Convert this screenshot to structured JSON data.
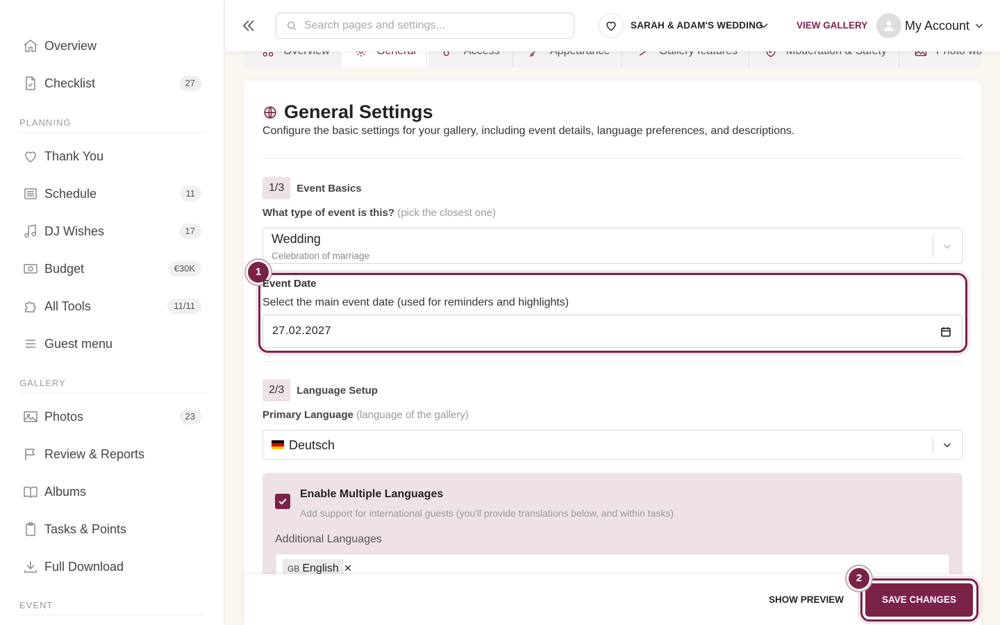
{
  "sidebar": {
    "top_items": [
      {
        "label": "Overview",
        "icon": "home-icon"
      },
      {
        "label": "Checklist",
        "icon": "checklist-icon",
        "badge": "27"
      }
    ],
    "sections": [
      {
        "title": "PLANNING"
      },
      {
        "title": "GALLERY"
      },
      {
        "title": "EVENT"
      }
    ],
    "planning_items": [
      {
        "label": "Thank You",
        "icon": "heart-icon"
      },
      {
        "label": "Schedule",
        "icon": "list-icon",
        "badge": "11"
      },
      {
        "label": "DJ Wishes",
        "icon": "music-note-icon",
        "badge": "17"
      },
      {
        "label": "Budget",
        "icon": "money-icon",
        "badge": "€30K"
      },
      {
        "label": "All Tools",
        "icon": "puzzle-icon",
        "badge": "11/11"
      },
      {
        "label": "Guest menu",
        "icon": "menu-icon"
      }
    ],
    "gallery_items": [
      {
        "label": "Photos",
        "icon": "image-icon",
        "badge": "23"
      },
      {
        "label": "Review & Reports",
        "icon": "flag-icon"
      },
      {
        "label": "Albums",
        "icon": "book-icon"
      },
      {
        "label": "Tasks & Points",
        "icon": "clipboard-icon"
      },
      {
        "label": "Full Download",
        "icon": "download-icon"
      }
    ]
  },
  "topbar": {
    "search_placeholder": "Search pages and settings...",
    "event_name": "SARAH & ADAM'S WEDDING",
    "view_gallery": "VIEW GALLERY",
    "account_label": "My Account"
  },
  "tabs": [
    "Overview",
    "General",
    "Access",
    "Appearance",
    "Gallery features",
    "Moderation & Safety",
    "Photo wa"
  ],
  "main": {
    "title": "General Settings",
    "description": "Configure the basic settings for your gallery, including event details, language preferences, and descriptions.",
    "step1": {
      "badge": "1/3",
      "title": "Event Basics"
    },
    "event_type": {
      "label": "What type of event is this?",
      "hint": "(pick the closest one)",
      "value": "Wedding",
      "sub": "Celebration of marriage"
    },
    "event_date": {
      "label": "Event Date",
      "description": "Select the main event date (used for reminders and highlights)",
      "value": "27.02.2027"
    },
    "step2": {
      "badge": "2/3",
      "title": "Language Setup"
    },
    "primary_language": {
      "label": "Primary Language",
      "hint": "(language of the gallery)",
      "value": "Deutsch"
    },
    "multi_lang": {
      "title": "Enable Multiple Languages",
      "description": "Add support for international guests (you'll provide translations below, and within tasks)",
      "checked": true,
      "additional_label": "Additional Languages",
      "chips": [
        {
          "code": "GB",
          "name": "English"
        }
      ]
    }
  },
  "markers": [
    "1",
    "2"
  ],
  "actions": {
    "show_preview": "SHOW PREVIEW",
    "save": "SAVE CHANGES"
  },
  "colors": {
    "accent": "#7b2249",
    "accent_light": "#efe2e7"
  }
}
